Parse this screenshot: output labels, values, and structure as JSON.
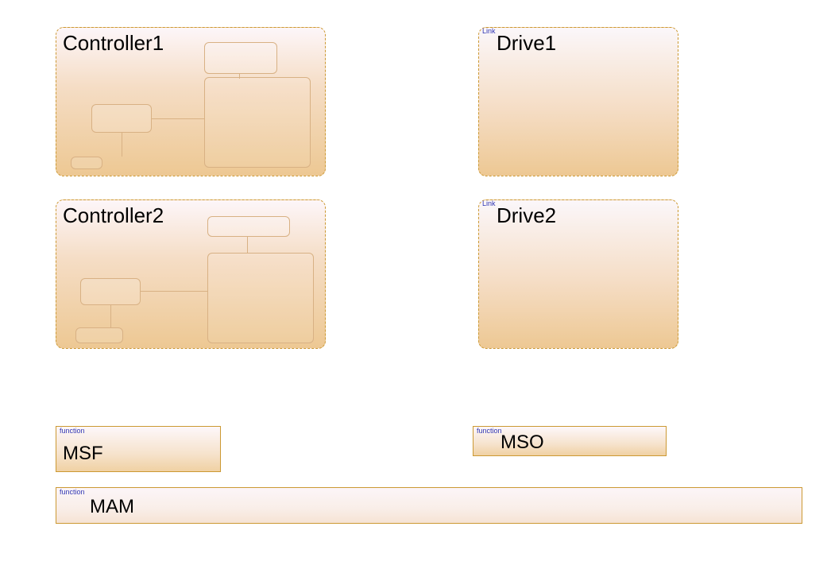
{
  "controllers": [
    {
      "title": "Controller1"
    },
    {
      "title": "Controller2"
    }
  ],
  "drives": [
    {
      "tag": "Link",
      "title": "Drive1"
    },
    {
      "tag": "Link",
      "title": "Drive2"
    }
  ],
  "functions": {
    "msf": {
      "tag": "function",
      "title": "MSF"
    },
    "mso": {
      "tag": "function",
      "title": "MSO"
    },
    "mam": {
      "tag": "function",
      "title": "MAM"
    }
  }
}
